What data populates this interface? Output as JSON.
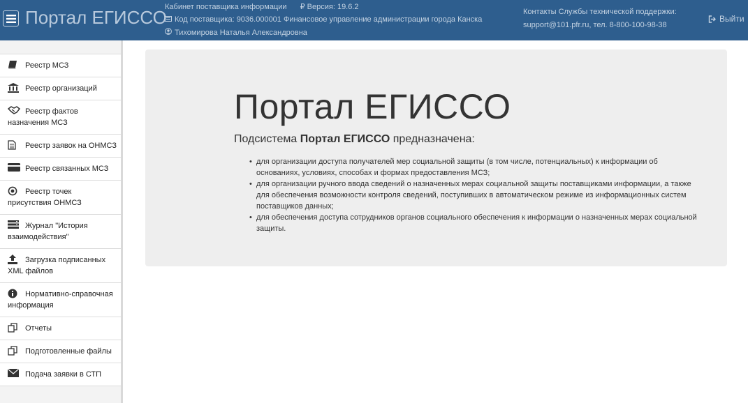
{
  "header": {
    "brand": "Портал ЕГИССО",
    "cabinet": "Кабинет поставщика информации",
    "version": "₽ Версия: 19.6.2",
    "supplier": "Код поставщика: 9036.000001 Финансовое управление администрации города Канска",
    "user": "Тихомирова Наталья Александровна",
    "support_line1": "Контакты Службы технической поддержки:",
    "support_line2": "support@101.pfr.ru, тел. 8-800-100-98-38",
    "logout": "Выйти"
  },
  "sidebar": {
    "items": [
      {
        "label": "Реестр МСЗ",
        "icon": "book-icon"
      },
      {
        "label": "Реестр организаций",
        "icon": "bank-icon"
      },
      {
        "label": "Реестр фактов назначения МСЗ",
        "icon": "handshake-icon"
      },
      {
        "label": "Реестр заявок на ОНМСЗ",
        "icon": "document-icon"
      },
      {
        "label": "Реестр связанных МСЗ",
        "icon": "credit-card-icon"
      },
      {
        "label": "Реестр точек присутствия ОНМСЗ",
        "icon": "target-icon"
      },
      {
        "label": "Журнал \"История взаимодействия\"",
        "icon": "server-icon"
      },
      {
        "label": "Загрузка подписанных XML файлов",
        "icon": "upload-icon"
      },
      {
        "label": "Нормативно-справочная информация",
        "icon": "info-icon"
      },
      {
        "label": "Отчеты",
        "icon": "copy-icon"
      },
      {
        "label": "Подготовленные файлы",
        "icon": "copy-icon"
      },
      {
        "label": "Подача заявки в СТП",
        "icon": "envelope-icon"
      }
    ]
  },
  "main": {
    "title": "Портал ЕГИССО",
    "subtitle_prefix": "Подсистема ",
    "subtitle_bold": "Портал ЕГИССО",
    "subtitle_suffix": " предназначена:",
    "bullets": [
      "для организации доступа получателей мер социальной защиты (в том числе, потенциальных) к информации об основаниях, условиях, способах и формах предоставления МСЗ;",
      "для организации ручного ввода сведений о назначенных мерах социальной защиты поставщиками информации, а также для обеспечения возможности контроля сведений, поступивших в автоматическом режиме из информационных систем поставщиков данных;",
      "для обеспечения доступа сотрудников органов социального обеспечения к информации о назначенных мерах социальной защиты."
    ]
  },
  "colors": {
    "header_bg": "#2e5e8e",
    "header_text": "#c3d2e2",
    "jumbotron_bg": "#eeeeee"
  }
}
